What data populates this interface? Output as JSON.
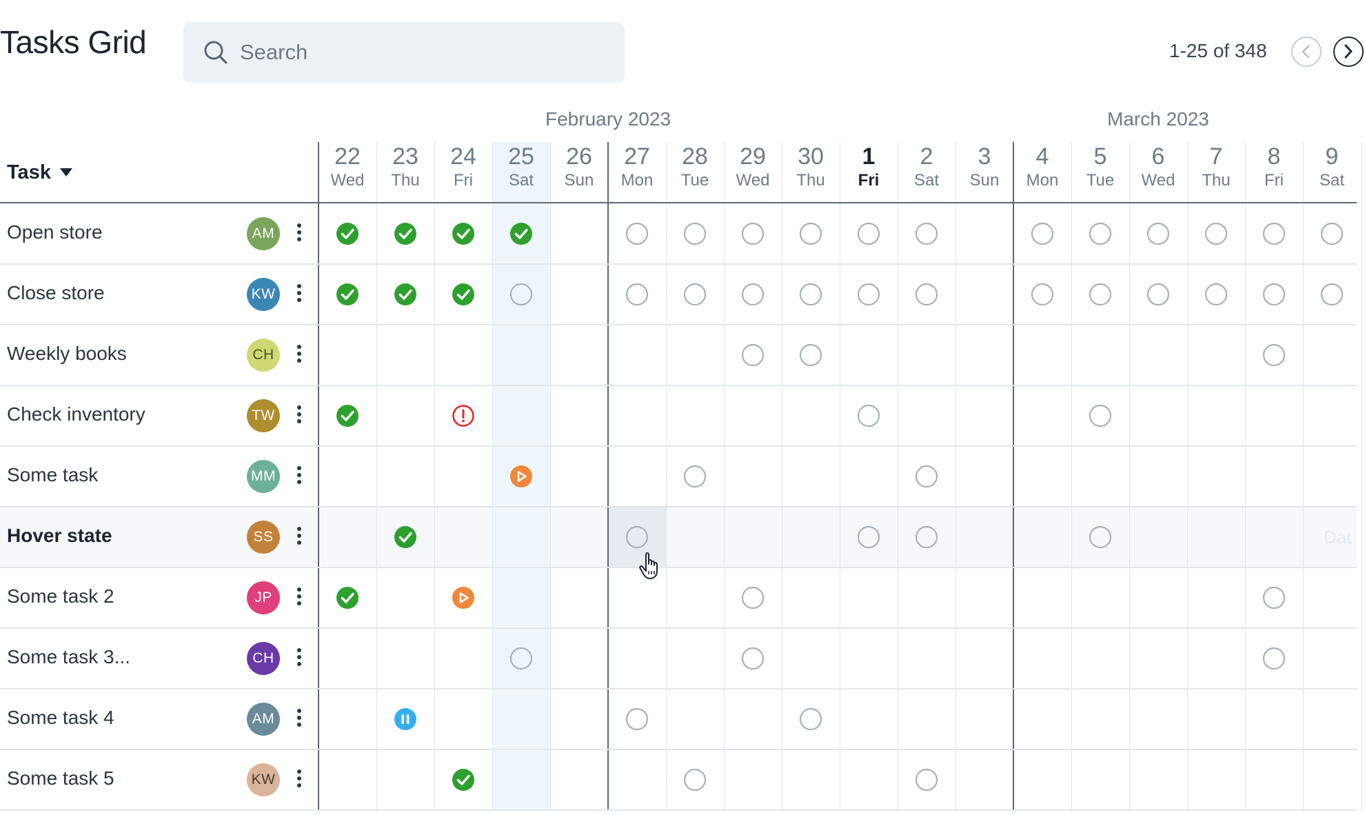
{
  "header": {
    "title": "Tasks Grid",
    "search_placeholder": "Search",
    "pagination": "1-25 of 348"
  },
  "months": [
    {
      "label": "February 2023",
      "column_index": 5
    },
    {
      "label": "March 2023",
      "column_index": 14
    }
  ],
  "task_column_header": "Task",
  "days": [
    {
      "num": "22",
      "day": "Wed"
    },
    {
      "num": "23",
      "day": "Thu"
    },
    {
      "num": "24",
      "day": "Fri"
    },
    {
      "num": "25",
      "day": "Sat"
    },
    {
      "num": "26",
      "day": "Sun"
    },
    {
      "num": "27",
      "day": "Mon"
    },
    {
      "num": "28",
      "day": "Tue"
    },
    {
      "num": "29",
      "day": "Wed"
    },
    {
      "num": "30",
      "day": "Thu"
    },
    {
      "num": "1",
      "day": "Fri",
      "today": true
    },
    {
      "num": "2",
      "day": "Sat"
    },
    {
      "num": "3",
      "day": "Sun"
    },
    {
      "num": "4",
      "day": "Mon"
    },
    {
      "num": "5",
      "day": "Tue"
    },
    {
      "num": "6",
      "day": "Wed"
    },
    {
      "num": "7",
      "day": "Thu"
    },
    {
      "num": "8",
      "day": "Fri"
    },
    {
      "num": "9",
      "day": "Sat"
    }
  ],
  "status_colors": {
    "done": "#2ea02e",
    "overdue": "#e02a2a",
    "in_progress": "#f0873a",
    "paused": "#35aef0",
    "empty": "#a8b0b8",
    "today_column_bg": "#eef6fc",
    "hover_row_bg": "#f6f8fa"
  },
  "status_icons": {
    "done": "check-circle-icon",
    "overdue": "alert-circle-icon",
    "in_progress": "play-circle-icon",
    "paused": "pause-circle-icon",
    "empty": "empty-circle-icon"
  },
  "rows": [
    {
      "name": "Open store",
      "initials": "AM",
      "avatar_color": "#7aa55a",
      "cells": [
        "done",
        "done",
        "done",
        "done",
        "",
        "empty",
        "empty",
        "empty",
        "empty",
        "empty",
        "empty",
        "",
        "empty",
        "empty",
        "empty",
        "empty",
        "empty",
        "empty"
      ]
    },
    {
      "name": "Close store",
      "initials": "KW",
      "avatar_color": "#3c86b4",
      "cells": [
        "done",
        "done",
        "done",
        "empty",
        "",
        "empty",
        "empty",
        "empty",
        "empty",
        "empty",
        "empty",
        "",
        "empty",
        "empty",
        "empty",
        "empty",
        "empty",
        "empty"
      ]
    },
    {
      "name": "Weekly books",
      "initials": "CH",
      "avatar_color": "#cfd873",
      "avatar_text_color": "#4a4f2a",
      "cells": [
        "",
        "",
        "",
        "",
        "",
        "",
        "",
        "empty",
        "empty",
        "",
        "",
        "",
        "",
        "",
        "",
        "",
        "empty",
        ""
      ]
    },
    {
      "name": "Check inventory",
      "initials": "TW",
      "avatar_color": "#b08d2e",
      "cells": [
        "done",
        "",
        "overdue",
        "",
        "",
        "",
        "",
        "",
        "",
        "empty",
        "",
        "",
        "",
        "empty",
        "",
        "",
        "",
        ""
      ]
    },
    {
      "name": "Some task",
      "initials": "MM",
      "avatar_color": "#6db09a",
      "cells": [
        "",
        "",
        "",
        "in_progress",
        "",
        "",
        "empty",
        "",
        "",
        "",
        "empty",
        "",
        "",
        "",
        "",
        "",
        "",
        ""
      ]
    },
    {
      "name": "Hover state",
      "initials": "SS",
      "avatar_color": "#c4813a",
      "bold": true,
      "hover": true,
      "cells": [
        "",
        "done",
        "",
        "",
        "",
        "empty",
        "",
        "",
        "",
        "empty",
        "empty",
        "",
        "",
        "empty",
        "",
        "",
        "",
        ""
      ]
    },
    {
      "name": "Some task 2",
      "initials": "JP",
      "avatar_color": "#e0407a",
      "cells": [
        "done",
        "",
        "in_progress",
        "",
        "",
        "",
        "",
        "empty",
        "",
        "",
        "",
        "",
        "",
        "",
        "",
        "",
        "empty",
        ""
      ]
    },
    {
      "name": "Some task 3...",
      "initials": "CH",
      "avatar_color": "#6a3aa8",
      "cells": [
        "",
        "",
        "",
        "empty",
        "",
        "",
        "",
        "empty",
        "",
        "",
        "",
        "",
        "",
        "",
        "",
        "",
        "empty",
        ""
      ]
    },
    {
      "name": "Some task 4",
      "initials": "AM",
      "avatar_color": "#6b8a9a",
      "cells": [
        "",
        "paused",
        "",
        "",
        "",
        "empty",
        "",
        "",
        "empty",
        "",
        "",
        "",
        "",
        "",
        "",
        "",
        "",
        ""
      ]
    },
    {
      "name": "Some task 5",
      "initials": "KW",
      "avatar_color": "#d9b39a",
      "avatar_text_color": "#4a3a30",
      "cells": [
        "",
        "",
        "done",
        "",
        "",
        "",
        "empty",
        "",
        "",
        "",
        "empty",
        "",
        "",
        "",
        "",
        "",
        "",
        ""
      ]
    }
  ],
  "hover_cell_placeholder": "Dat"
}
